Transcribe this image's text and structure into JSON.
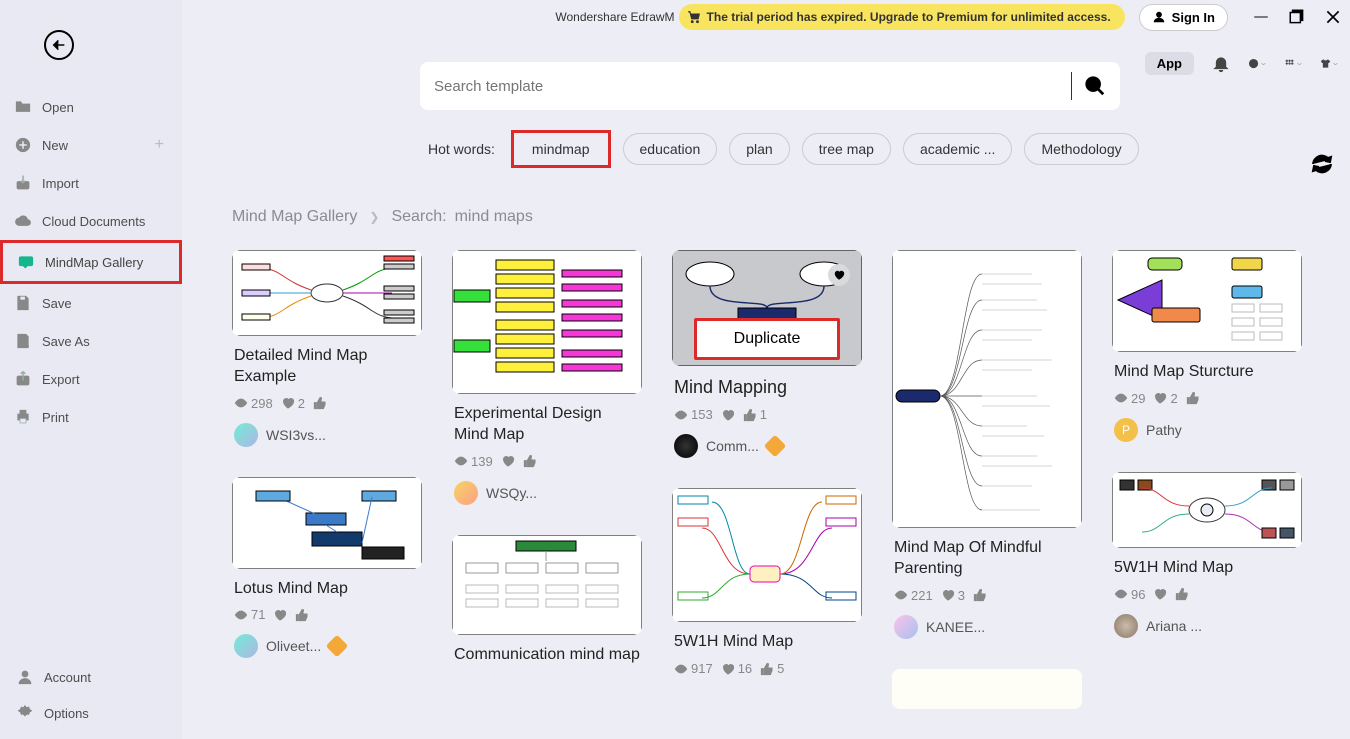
{
  "titlebar": {
    "app_title": "Wondershare EdrawM",
    "trial_text": "The trial period has expired. Upgrade to Premium for unlimited access.",
    "signin": "Sign In"
  },
  "toolbar": {
    "app_label": "App"
  },
  "sidebar": {
    "open": "Open",
    "new": "New",
    "import": "Import",
    "cloud": "Cloud Documents",
    "gallery": "MindMap Gallery",
    "save": "Save",
    "saveas": "Save As",
    "export": "Export",
    "print": "Print",
    "account": "Account",
    "options": "Options"
  },
  "search": {
    "placeholder": "Search template"
  },
  "hotwords": {
    "label": "Hot words:",
    "mindmap": "mindmap",
    "education": "education",
    "plan": "plan",
    "treemap": "tree map",
    "academic": "academic ...",
    "methodology": "Methodology"
  },
  "breadcrumb": {
    "gallery": "Mind Map Gallery",
    "search_label": "Search:",
    "query": "mind maps"
  },
  "cards": {
    "c1": {
      "title": "Detailed Mind Map Example",
      "views": "298",
      "loves": "2",
      "author": "WSI3vs..."
    },
    "c2": {
      "title": "Lotus Mind Map",
      "views": "71",
      "author": "Oliveet..."
    },
    "c3": {
      "title": "Experimental Design Mind Map",
      "views": "139",
      "author": "WSQy..."
    },
    "c4": {
      "title": "Communication mind map"
    },
    "c5": {
      "title": "Mind Mapping",
      "views": "153",
      "loves": "1",
      "author": "Comm...",
      "duplicate": "Duplicate"
    },
    "c6": {
      "title": "5W1H Mind Map",
      "views": "917",
      "loves": "16",
      "likes": "5"
    },
    "c7": {
      "title": "Mind Map Of Mindful Parenting",
      "views": "221",
      "loves": "3",
      "author": "KANEE..."
    },
    "c8": {
      "title": "Mind Map Sturcture",
      "views": "29",
      "loves": "2",
      "author": "Pathy"
    },
    "c9": {
      "title": "5W1H Mind Map",
      "views": "96",
      "author": "Ariana ..."
    }
  }
}
